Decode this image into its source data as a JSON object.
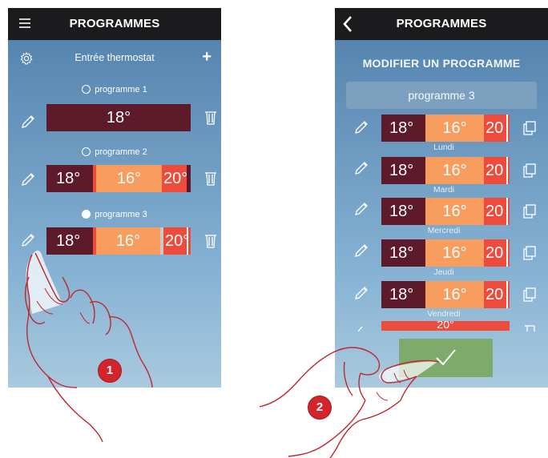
{
  "left_screen": {
    "title": "PROGRAMMES",
    "menu_icon": "hamburger-icon",
    "subheader": {
      "label": "Entrée thermostat",
      "gear_icon": "gear-icon",
      "add_icon": "plus-icon"
    },
    "programs": [
      {
        "name": "programme 1",
        "selected": false,
        "temps": [
          "18°"
        ]
      },
      {
        "name": "programme 2",
        "selected": false,
        "temps": [
          "18°",
          "16°",
          "20°"
        ]
      },
      {
        "name": "programme 3",
        "selected": true,
        "temps": [
          "18°",
          "16°",
          "20°"
        ]
      }
    ]
  },
  "right_screen": {
    "title": "PROGRAMMES",
    "back_icon": "chevron-left-icon",
    "heading": "MODIFIER UN PROGRAMME",
    "program_name": "programme 3",
    "days": [
      {
        "label": "Lundi",
        "temps": [
          "18°",
          "16°",
          "20"
        ]
      },
      {
        "label": "Mardi",
        "temps": [
          "18°",
          "16°",
          "20"
        ]
      },
      {
        "label": "Mercredi",
        "temps": [
          "18°",
          "16°",
          "20"
        ]
      },
      {
        "label": "Jeudi",
        "temps": [
          "18°",
          "16°",
          "20"
        ]
      },
      {
        "label": "Vendredi",
        "temps": [
          "18°",
          "16°",
          "20"
        ]
      }
    ],
    "partial_row_temp": "20°",
    "confirm_icon": "checkmark-icon"
  },
  "callouts": [
    "1",
    "2"
  ],
  "colors": {
    "topbar": "#1b1b1d",
    "maroon": "#5c1a2b",
    "orange": "#f89d5e",
    "red": "#ee4b3c",
    "confirm": "#7eaa6c",
    "callout": "#d3242b"
  }
}
